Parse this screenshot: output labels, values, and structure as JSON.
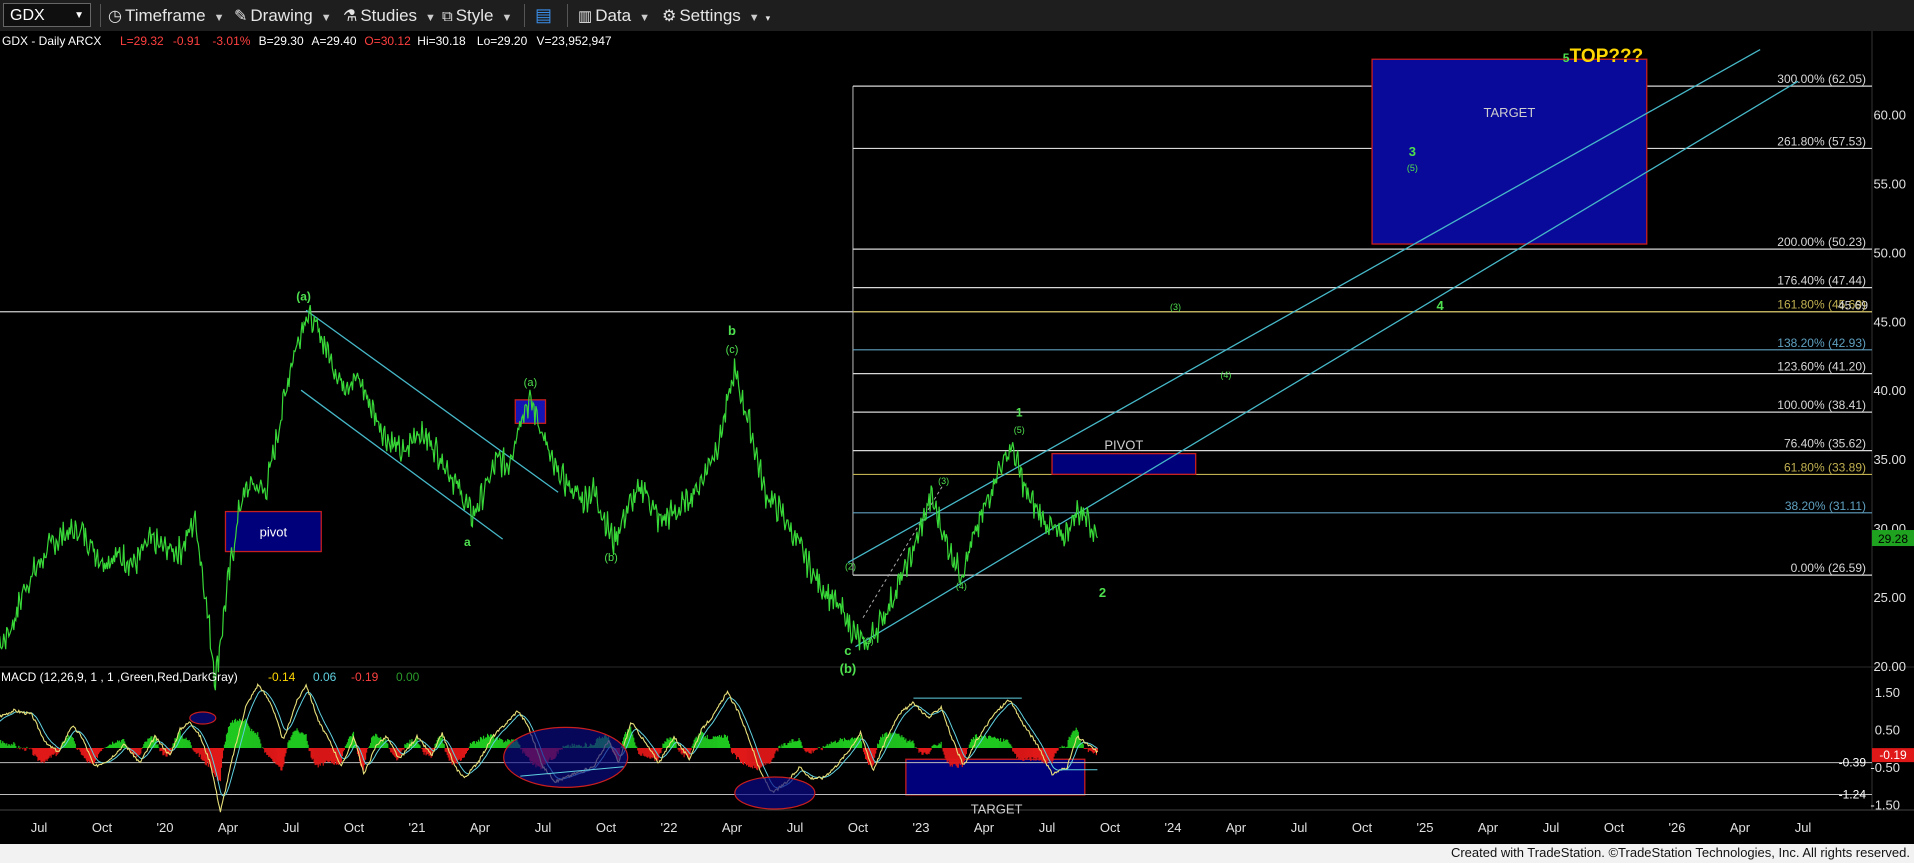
{
  "toolbar": {
    "symbol": "GDX",
    "timeframe": "Timeframe",
    "drawing": "Drawing",
    "studies": "Studies",
    "style": "Style",
    "data": "Data",
    "settings": "Settings"
  },
  "chart_data": {
    "type": "line",
    "title": "GDX - Daily  ARCX",
    "quote": [
      {
        "text": "L=29.32",
        "color": "#ff4040"
      },
      {
        "text": "-0.91",
        "color": "#ff4040"
      },
      {
        "text": "-3.01%",
        "color": "#ff4040"
      },
      {
        "text": "B=29.30",
        "color": "#ffffff"
      },
      {
        "text": "A=29.40",
        "color": "#ffffff"
      },
      {
        "text": "O=30.12",
        "color": "#ff4040"
      },
      {
        "text": "Hi=30.18",
        "color": "#ffffff"
      },
      {
        "text": "Lo=29.20",
        "color": "#ffffff"
      },
      {
        "text": "V=23,952,947",
        "color": "#ffffff"
      }
    ],
    "last_price_label": "29.28",
    "price_axis": {
      "min": 17.5,
      "max": 65,
      "ticks": [
        "20.00",
        "25.00",
        "30.00",
        "35.00",
        "40.00",
        "45.00",
        "50.00",
        "55.00",
        "60.00"
      ]
    },
    "time_axis": {
      "labels": [
        "Jul",
        "Oct",
        "'20",
        "Apr",
        "Jul",
        "Oct",
        "'21",
        "Apr",
        "Jul",
        "Oct",
        "'22",
        "Apr",
        "Jul",
        "Oct",
        "'23",
        "Apr",
        "Jul",
        "Oct",
        "'24",
        "Apr",
        "Jul",
        "Oct",
        "'25",
        "Apr",
        "Jul",
        "Oct",
        "'26",
        "Apr",
        "Jul"
      ],
      "start": 2019.5,
      "step": 0.25
    },
    "price_series_anchors": [
      [
        2019.24,
        20.6
      ],
      [
        2019.3,
        20.1
      ],
      [
        2019.36,
        21.8
      ],
      [
        2019.4,
        23.2
      ],
      [
        2019.44,
        25.6
      ],
      [
        2019.5,
        27.4
      ],
      [
        2019.55,
        28.8
      ],
      [
        2019.6,
        29.6
      ],
      [
        2019.67,
        29.8
      ],
      [
        2019.75,
        27.6
      ],
      [
        2019.82,
        28.0
      ],
      [
        2019.88,
        27.4
      ],
      [
        2019.94,
        29.1
      ],
      [
        2019.99,
        28.6
      ],
      [
        2020.06,
        28.3
      ],
      [
        2020.12,
        30.7
      ],
      [
        2020.16,
        25.2
      ],
      [
        2020.2,
        19.0
      ],
      [
        2020.25,
        26.1
      ],
      [
        2020.3,
        31.9
      ],
      [
        2020.34,
        33.2
      ],
      [
        2020.4,
        32.7
      ],
      [
        2020.44,
        36.2
      ],
      [
        2020.5,
        41.9
      ],
      [
        2020.56,
        45.6
      ],
      [
        2020.62,
        43.9
      ],
      [
        2020.7,
        40.5
      ],
      [
        2020.77,
        40.8
      ],
      [
        2020.82,
        38.7
      ],
      [
        2020.88,
        36.5
      ],
      [
        2020.95,
        35.3
      ],
      [
        2021.0,
        37.1
      ],
      [
        2021.06,
        36.1
      ],
      [
        2021.12,
        34.4
      ],
      [
        2021.18,
        32.3
      ],
      [
        2021.22,
        30.8
      ],
      [
        2021.26,
        32.4
      ],
      [
        2021.32,
        35.0
      ],
      [
        2021.36,
        34.5
      ],
      [
        2021.42,
        38.6
      ],
      [
        2021.45,
        39.2
      ],
      [
        2021.48,
        37.9
      ],
      [
        2021.54,
        34.4
      ],
      [
        2021.6,
        33.1
      ],
      [
        2021.66,
        32.0
      ],
      [
        2021.7,
        32.8
      ],
      [
        2021.78,
        29.0
      ],
      [
        2021.84,
        31.6
      ],
      [
        2021.9,
        33.0
      ],
      [
        2021.96,
        30.5
      ],
      [
        2022.04,
        31.3
      ],
      [
        2022.12,
        33.1
      ],
      [
        2022.2,
        36.4
      ],
      [
        2022.26,
        41.3
      ],
      [
        2022.32,
        37.5
      ],
      [
        2022.38,
        32.6
      ],
      [
        2022.45,
        31.0
      ],
      [
        2022.52,
        28.6
      ],
      [
        2022.58,
        26.4
      ],
      [
        2022.64,
        25.0
      ],
      [
        2022.7,
        23.6
      ],
      [
        2022.74,
        22.2
      ],
      [
        2022.78,
        21.4
      ],
      [
        2022.84,
        23.2
      ],
      [
        2022.9,
        25.4
      ],
      [
        2022.98,
        28.9
      ],
      [
        2023.04,
        32.3
      ],
      [
        2023.1,
        29.0
      ],
      [
        2023.16,
        26.7
      ],
      [
        2023.24,
        30.8
      ],
      [
        2023.3,
        34.0
      ],
      [
        2023.36,
        35.9
      ],
      [
        2023.42,
        32.4
      ],
      [
        2023.48,
        30.8
      ],
      [
        2023.56,
        29.2
      ],
      [
        2023.62,
        31.2
      ],
      [
        2023.66,
        31.0
      ],
      [
        2023.7,
        29.28
      ]
    ],
    "fib_levels": [
      {
        "label": "300.00% (62.05)",
        "price": 62.05,
        "color": "#d8d8d8"
      },
      {
        "label": "261.80% (57.53)",
        "price": 57.53,
        "color": "#d8d8d8"
      },
      {
        "label": "200.00% (50.23)",
        "price": 50.23,
        "color": "#d8d8d8"
      },
      {
        "label": "176.40% (47.44)",
        "price": 47.44,
        "color": "#d8d8d8"
      },
      {
        "label": "161.80% (45.69)",
        "price": 45.69,
        "color": "#c0b050"
      },
      {
        "label": "138.20% (42.93)",
        "price": 42.93,
        "color": "#5fa0c0"
      },
      {
        "label": "123.60% (41.20)",
        "price": 41.2,
        "color": "#d8d8d8"
      },
      {
        "label": "100.00% (38.41)",
        "price": 38.41,
        "color": "#d8d8d8"
      },
      {
        "label": "76.40% (35.62)",
        "price": 35.62,
        "color": "#d8d8d8"
      },
      {
        "label": "61.80% (33.89)",
        "price": 33.89,
        "color": "#c0b050"
      },
      {
        "label": "38.20% (31.11)",
        "price": 31.11,
        "color": "#5fa0c0"
      },
      {
        "label": "0.00% (26.59)",
        "price": 26.59,
        "color": "#d8d8d8"
      }
    ],
    "fib_overlap_label": "45.69",
    "horizontal_line_price": 45.69,
    "zones": [
      {
        "label": "pivot",
        "t1": 2020.24,
        "t2": 2020.62,
        "p1": 28.3,
        "p2": 31.2,
        "fill": "#00007a",
        "border": "#c81e1e",
        "label_color": "#ffffff"
      },
      {
        "label": "",
        "t1": 2021.39,
        "t2": 2021.51,
        "p1": 37.6,
        "p2": 39.3,
        "fill": "#1515b5",
        "border": "#c81e1e",
        "label_color": "#ffffff"
      },
      {
        "label": "PIVOT",
        "t1": 2023.52,
        "t2": 2024.09,
        "p1": 33.9,
        "p2": 35.4,
        "fill": "#00007a",
        "border": "#c81e1e",
        "label_color": "#cfcfcf"
      },
      {
        "label": "TARGET",
        "t1": 2024.79,
        "t2": 2025.88,
        "p1": 50.6,
        "p2": 64.0,
        "fill": "#0a0a9a",
        "border": "#c81e1e",
        "label_color": "#cfcfcf"
      }
    ],
    "trendlines": [
      {
        "t1": 2020.56,
        "p1": 45.8,
        "t2": 2021.56,
        "p2": 32.6,
        "color": "#46b8c8"
      },
      {
        "t1": 2020.54,
        "p1": 40.0,
        "t2": 2021.34,
        "p2": 29.2,
        "color": "#46b8c8"
      },
      {
        "t1": 2022.71,
        "p1": 27.5,
        "t2": 2026.33,
        "p2": 64.7,
        "color": "#46b8c8"
      },
      {
        "t1": 2022.74,
        "p1": 21.4,
        "t2": 2026.48,
        "p2": 62.4,
        "color": "#46b8c8"
      }
    ],
    "fib_anchor_time": 2022.73,
    "wave_labels": [
      {
        "text": "(a)",
        "t": 2020.55,
        "p": 46.5,
        "size": 12,
        "color": "#4ee04e"
      },
      {
        "text": "a",
        "t": 2021.2,
        "p": 28.7,
        "size": 12,
        "color": "#4ee04e"
      },
      {
        "text": "(a)",
        "t": 2021.45,
        "p": 40.3,
        "size": 11,
        "color": "#4ee04e"
      },
      {
        "text": "(b)",
        "t": 2021.77,
        "p": 27.6,
        "size": 11,
        "color": "#4ee04e"
      },
      {
        "text": "b",
        "t": 2022.25,
        "p": 44.0,
        "size": 13,
        "color": "#4ee04e"
      },
      {
        "text": "(c)",
        "t": 2022.25,
        "p": 42.7,
        "size": 11,
        "color": "#4ee04e"
      },
      {
        "text": "(2)",
        "t": 2022.72,
        "p": 27.0,
        "size": 9,
        "color": "#4ee04e"
      },
      {
        "text": "(2)",
        "t": 2022.79,
        "p": 21.6,
        "size": 9,
        "color": "#4ee04e"
      },
      {
        "text": "c",
        "t": 2022.71,
        "p": 20.8,
        "size": 13,
        "color": "#4ee04e"
      },
      {
        "text": "(b)",
        "t": 2022.71,
        "p": 19.5,
        "size": 13,
        "color": "#4ee04e"
      },
      {
        "text": "(3)",
        "t": 2023.09,
        "p": 33.2,
        "size": 9,
        "color": "#4ee04e"
      },
      {
        "text": "(4)",
        "t": 2023.16,
        "p": 25.6,
        "size": 9,
        "color": "#4ee04e"
      },
      {
        "text": "1",
        "t": 2023.39,
        "p": 38.1,
        "size": 12,
        "color": "#4ee04e"
      },
      {
        "text": "(5)",
        "t": 2023.39,
        "p": 36.9,
        "size": 9,
        "color": "#4ee04e"
      },
      {
        "text": "2",
        "t": 2023.72,
        "p": 25.0,
        "size": 13,
        "color": "#4ee04e"
      },
      {
        "text": "(3)",
        "t": 2024.01,
        "p": 45.8,
        "size": 9,
        "color": "#4ee04e"
      },
      {
        "text": "(4)",
        "t": 2024.21,
        "p": 40.9,
        "size": 9,
        "color": "#4ee04e"
      },
      {
        "text": "3",
        "t": 2024.95,
        "p": 57.0,
        "size": 13,
        "color": "#4ee04e"
      },
      {
        "text": "(5)",
        "t": 2024.95,
        "p": 55.9,
        "size": 9,
        "color": "#4ee04e"
      },
      {
        "text": "4",
        "t": 2025.06,
        "p": 45.8,
        "size": 13,
        "color": "#4ee04e"
      },
      {
        "text": "5",
        "t": 2025.56,
        "p": 63.8,
        "size": 12,
        "color": "#4ee04e"
      },
      {
        "text": "TOP???",
        "t": 2025.72,
        "p": 63.8,
        "size": 19,
        "color": "#ffd700"
      }
    ],
    "macd": {
      "title": "MACD (12,26,9, 1 , 1 ,Green,Red,DarkGray)",
      "values": [
        {
          "text": "-0.14",
          "color": "#ffd700"
        },
        {
          "text": "0.06",
          "color": "#5fd0e0"
        },
        {
          "text": "-0.19",
          "color": "#ff4040"
        },
        {
          "text": "0.00",
          "color": "#2a9a2a"
        }
      ],
      "axis": {
        "min": -1.8,
        "max": 1.8,
        "ticks": [
          "1.50",
          "0.50",
          "-0.50",
          "-1.50"
        ]
      },
      "level_labels": [
        {
          "text": "-0.39",
          "value": -0.39,
          "color": "#ffffff"
        },
        {
          "text": "-1.24",
          "value": -1.24,
          "color": "#ffffff"
        }
      ],
      "last_label": "-0.19",
      "target_label": "TARGET",
      "target_zone": {
        "t1": 2022.94,
        "t2": 2023.65,
        "v1": -0.3,
        "v2": -1.25
      },
      "macd_anchors": [
        [
          2019.24,
          -0.3
        ],
        [
          2019.28,
          0.2
        ],
        [
          2019.33,
          0.8
        ],
        [
          2019.4,
          1.0
        ],
        [
          2019.47,
          0.9
        ],
        [
          2019.53,
          0.1
        ],
        [
          2019.58,
          -0.1
        ],
        [
          2019.63,
          0.6
        ],
        [
          2019.67,
          0.3
        ],
        [
          2019.72,
          -0.5
        ],
        [
          2019.78,
          -0.3
        ],
        [
          2019.84,
          0.1
        ],
        [
          2019.9,
          -0.4
        ],
        [
          2019.96,
          0.3
        ],
        [
          2020.02,
          -0.2
        ],
        [
          2020.06,
          0.5
        ],
        [
          2020.1,
          0.7
        ],
        [
          2020.14,
          0.3
        ],
        [
          2020.18,
          -0.4
        ],
        [
          2020.22,
          -1.7
        ],
        [
          2020.27,
          -0.2
        ],
        [
          2020.32,
          1.1
        ],
        [
          2020.37,
          1.7
        ],
        [
          2020.42,
          1.2
        ],
        [
          2020.47,
          0.2
        ],
        [
          2020.52,
          1.2
        ],
        [
          2020.56,
          1.7
        ],
        [
          2020.61,
          0.7
        ],
        [
          2020.66,
          0.1
        ],
        [
          2020.7,
          -0.5
        ],
        [
          2020.75,
          0.3
        ],
        [
          2020.79,
          -0.7
        ],
        [
          2020.84,
          0.1
        ],
        [
          2020.88,
          0.3
        ],
        [
          2020.93,
          -0.3
        ],
        [
          2021.0,
          0.3
        ],
        [
          2021.06,
          -0.2
        ],
        [
          2021.1,
          0.4
        ],
        [
          2021.15,
          -0.5
        ],
        [
          2021.19,
          -0.8
        ],
        [
          2021.25,
          -0.3
        ],
        [
          2021.3,
          0.3
        ],
        [
          2021.36,
          0.7
        ],
        [
          2021.4,
          1.0
        ],
        [
          2021.44,
          0.6
        ],
        [
          2021.5,
          -0.5
        ],
        [
          2021.55,
          -0.9
        ],
        [
          2021.62,
          -0.7
        ],
        [
          2021.7,
          -0.5
        ],
        [
          2021.76,
          0.2
        ],
        [
          2021.8,
          -0.4
        ],
        [
          2021.85,
          0.7
        ],
        [
          2021.9,
          0.2
        ],
        [
          2021.96,
          -0.4
        ],
        [
          2022.02,
          0.3
        ],
        [
          2022.08,
          -0.3
        ],
        [
          2022.13,
          0.5
        ],
        [
          2022.18,
          0.9
        ],
        [
          2022.23,
          1.5
        ],
        [
          2022.28,
          0.9
        ],
        [
          2022.32,
          0.2
        ],
        [
          2022.36,
          -0.6
        ],
        [
          2022.41,
          -1.2
        ],
        [
          2022.47,
          -0.9
        ],
        [
          2022.52,
          -0.5
        ],
        [
          2022.56,
          -0.8
        ],
        [
          2022.61,
          -0.8
        ],
        [
          2022.66,
          -0.5
        ],
        [
          2022.71,
          -0.1
        ],
        [
          2022.76,
          0.4
        ],
        [
          2022.81,
          -0.6
        ],
        [
          2022.86,
          0.2
        ],
        [
          2022.91,
          0.9
        ],
        [
          2022.97,
          1.2
        ],
        [
          2023.03,
          0.8
        ],
        [
          2023.08,
          1.1
        ],
        [
          2023.12,
          0.3
        ],
        [
          2023.17,
          -0.5
        ],
        [
          2023.22,
          0.2
        ],
        [
          2023.29,
          0.9
        ],
        [
          2023.35,
          1.3
        ],
        [
          2023.4,
          0.7
        ],
        [
          2023.46,
          0.1
        ],
        [
          2023.52,
          -0.7
        ],
        [
          2023.58,
          -0.5
        ],
        [
          2023.62,
          0.3
        ],
        [
          2023.66,
          0.1
        ],
        [
          2023.7,
          -0.1
        ]
      ]
    },
    "footer": "Created with TradeStation. ©TradeStation Technologies, Inc. All rights reserved."
  }
}
